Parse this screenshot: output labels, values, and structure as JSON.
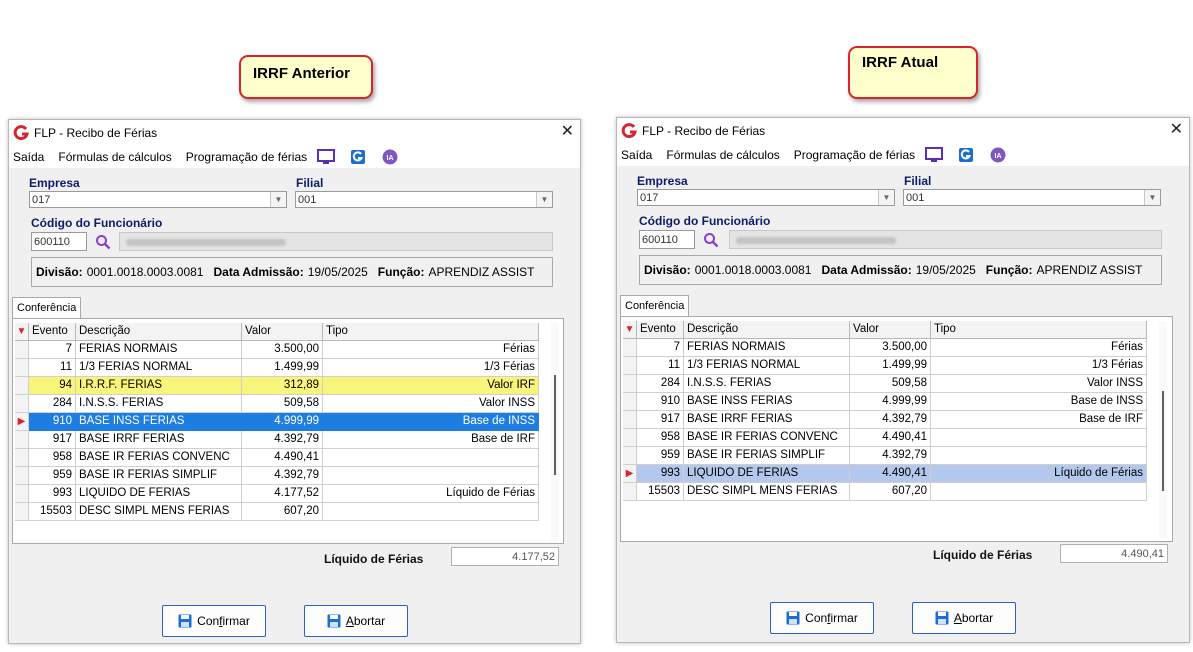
{
  "callouts": {
    "left": "IRRF Anterior",
    "right": "IRRF Atual"
  },
  "common": {
    "title": "FLP - Recibo de Férias",
    "close": "✕",
    "menu": [
      "Saída",
      "Fórmulas de cálculos",
      "Programação de férias"
    ],
    "labels": {
      "empresa": "Empresa",
      "filial": "Filial",
      "codigo": "Código do Funcionário",
      "divisao": "Divisão:",
      "admissao": "Data Admissão:",
      "funcao": "Função:",
      "tab": "Conferência",
      "liquido": "Líquido de Férias"
    },
    "empresa": "017",
    "filial": "001",
    "codigo": "600110",
    "divisao": "0001.0018.0003.0081",
    "admissao": "19/05/2025",
    "funcao": "APRENDIZ ASSIST",
    "columns": [
      "Evento",
      "Descrição",
      "Valor",
      "Tipo"
    ],
    "buttons": {
      "confirmar_pre": "Con",
      "confirmar_u": "f",
      "confirmar_post": "irmar",
      "abortar_u": "A",
      "abortar_post": "bortar"
    },
    "icons": {
      "logo": "flp-logo-icon",
      "monitor": "monitor-icon",
      "g": "g-app-icon",
      "ia": "ia-icon",
      "search": "search-icon",
      "save": "save-icon"
    },
    "colors": {
      "accent": "#d8242e",
      "label": "#0c1d6b",
      "selected": "#1e7de0",
      "highlight": "#f8f57a",
      "lightselected": "#b4c7ec"
    }
  },
  "left": {
    "rows": [
      {
        "evento": "7",
        "descricao": "FERIAS NORMAIS",
        "valor": "3.500,00",
        "tipo": "Férias"
      },
      {
        "evento": "11",
        "descricao": "1/3 FERIAS NORMAL",
        "valor": "1.499,99",
        "tipo": "1/3 Férias"
      },
      {
        "evento": "94",
        "descricao": "I.R.R.F. FERIAS",
        "valor": "312,89",
        "tipo": "Valor IRF"
      },
      {
        "evento": "284",
        "descricao": "I.N.S.S. FERIAS",
        "valor": "509,58",
        "tipo": "Valor INSS"
      },
      {
        "evento": "910",
        "descricao": "BASE INSS FERIAS",
        "valor": "4.999,99",
        "tipo": "Base de INSS"
      },
      {
        "evento": "917",
        "descricao": "BASE IRRF FERIAS",
        "valor": "4.392,79",
        "tipo": "Base de IRF"
      },
      {
        "evento": "958",
        "descricao": "BASE IR FERIAS CONVENC",
        "valor": "4.490,41",
        "tipo": ""
      },
      {
        "evento": "959",
        "descricao": "BASE IR FERIAS SIMPLIF",
        "valor": "4.392,79",
        "tipo": ""
      },
      {
        "evento": "993",
        "descricao": "LIQUIDO DE FERIAS",
        "valor": "4.177,52",
        "tipo": "Líquido de Férias"
      },
      {
        "evento": "15503",
        "descricao": "DESC SIMPL MENS FERIAS",
        "valor": "607,20",
        "tipo": ""
      }
    ],
    "liquido": "4.177,52"
  },
  "right": {
    "rows": [
      {
        "evento": "7",
        "descricao": "FERIAS NORMAIS",
        "valor": "3.500,00",
        "tipo": "Férias"
      },
      {
        "evento": "11",
        "descricao": "1/3 FERIAS NORMAL",
        "valor": "1.499,99",
        "tipo": "1/3 Férias"
      },
      {
        "evento": "284",
        "descricao": "I.N.S.S. FERIAS",
        "valor": "509,58",
        "tipo": "Valor INSS"
      },
      {
        "evento": "910",
        "descricao": "BASE INSS FERIAS",
        "valor": "4.999,99",
        "tipo": "Base de INSS"
      },
      {
        "evento": "917",
        "descricao": "BASE IRRF FERIAS",
        "valor": "4.392,79",
        "tipo": "Base de IRF"
      },
      {
        "evento": "958",
        "descricao": "BASE IR FERIAS CONVENC",
        "valor": "4.490,41",
        "tipo": ""
      },
      {
        "evento": "959",
        "descricao": "BASE IR FERIAS SIMPLIF",
        "valor": "4.392,79",
        "tipo": ""
      },
      {
        "evento": "993",
        "descricao": "LIQUIDO DE FERIAS",
        "valor": "4.490,41",
        "tipo": "Líquido de Férias"
      },
      {
        "evento": "15503",
        "descricao": "DESC SIMPL MENS FERIAS",
        "valor": "607,20",
        "tipo": ""
      }
    ],
    "liquido": "4.490,41"
  }
}
